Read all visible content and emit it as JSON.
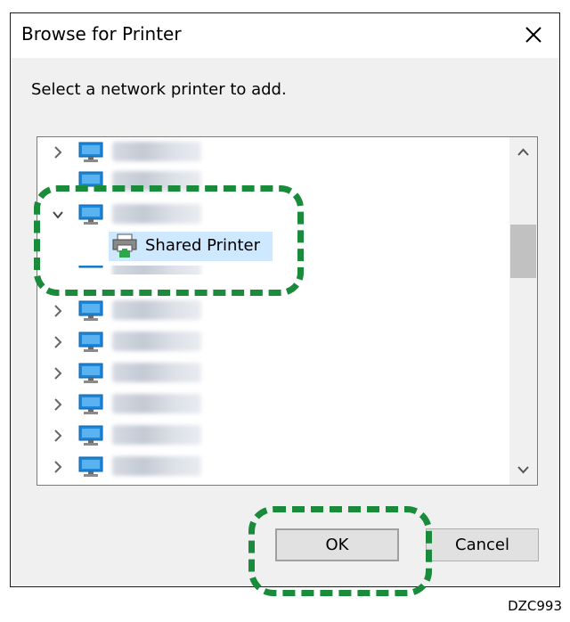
{
  "dialog": {
    "title": "Browse for Printer",
    "instruction": "Select a network printer to add.",
    "close_icon": "close-icon"
  },
  "tree": {
    "shared_printer_label": "Shared Printer",
    "items": [
      {
        "state": "collapsed",
        "icon": "computer-icon"
      },
      {
        "state": "collapsed",
        "icon": "computer-icon"
      },
      {
        "state": "expanded",
        "icon": "computer-icon"
      },
      {
        "state": "collapsed",
        "icon": "computer-icon"
      },
      {
        "state": "collapsed",
        "icon": "computer-icon"
      },
      {
        "state": "collapsed",
        "icon": "computer-icon"
      },
      {
        "state": "collapsed",
        "icon": "computer-icon"
      },
      {
        "state": "collapsed",
        "icon": "computer-icon"
      },
      {
        "state": "collapsed",
        "icon": "computer-icon"
      },
      {
        "state": "collapsed",
        "icon": "computer-icon"
      }
    ]
  },
  "buttons": {
    "ok": "OK",
    "cancel": "Cancel"
  },
  "colors": {
    "highlight": "#1a8a3b",
    "selection": "#cde8ff",
    "dialog_bg": "#f0f0f0"
  },
  "figure_code": "DZC993"
}
